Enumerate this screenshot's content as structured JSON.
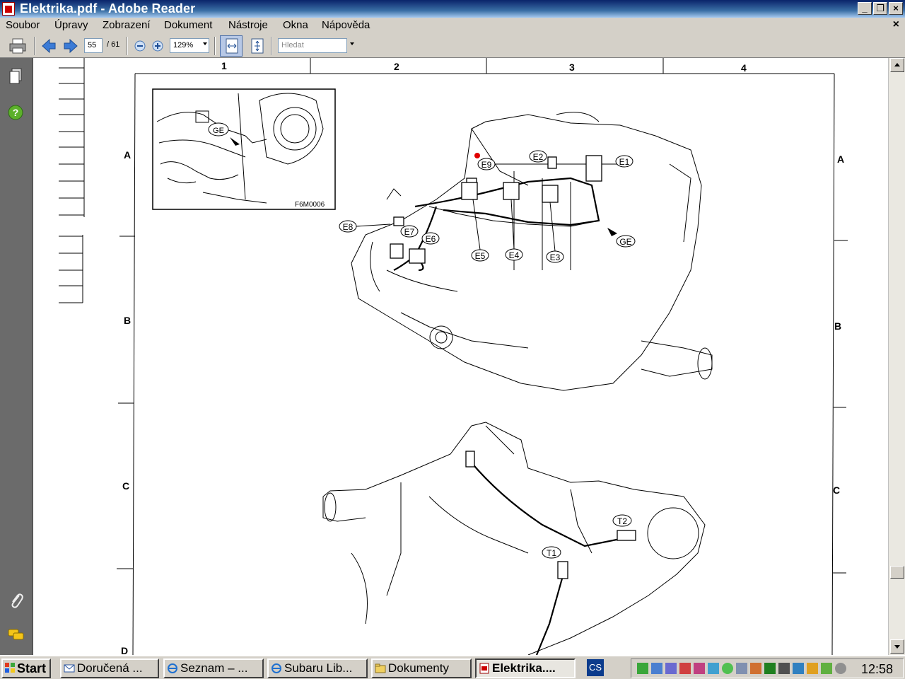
{
  "window": {
    "title": "Elektrika.pdf - Adobe Reader",
    "colors": {
      "titlebar": "#0a246a",
      "chrome": "#d4d0c8"
    }
  },
  "menu": {
    "items": [
      "Soubor",
      "Úpravy",
      "Zobrazení",
      "Dokument",
      "Nástroje",
      "Okna",
      "Nápověda"
    ],
    "close_glyph": "×"
  },
  "toolbar": {
    "page_number": "55",
    "page_count": "/ 61",
    "zoom": "129%",
    "search_placeholder": "Hledat"
  },
  "navpanel": {
    "icons": [
      "pages-icon",
      "help-icon",
      "attachments-icon",
      "comments-icon"
    ]
  },
  "document": {
    "column_labels": [
      "1",
      "2",
      "3",
      "4"
    ],
    "row_labels": [
      "A",
      "B",
      "C",
      "D"
    ],
    "inset_code": "F6M0006",
    "callouts": [
      "GE",
      "E9",
      "E2",
      "E1",
      "E8",
      "E7",
      "E6",
      "E5",
      "E4",
      "E3",
      "GE",
      "T2",
      "T1"
    ]
  },
  "taskbar": {
    "start_label": "Start",
    "tasks": [
      "Doručená ...",
      "Seznam – ...",
      "Subaru Lib...",
      "Dokumenty",
      "Elektrika...."
    ],
    "language": "CS",
    "clock": "12:58"
  }
}
